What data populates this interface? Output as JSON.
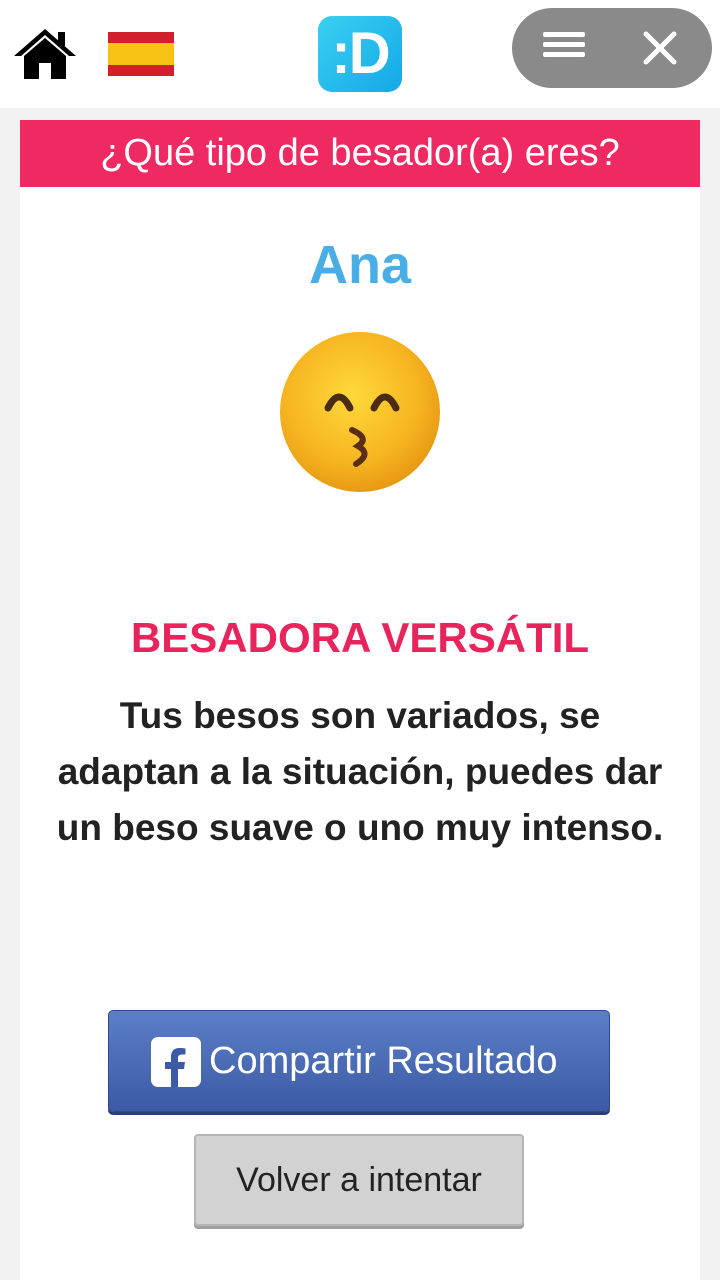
{
  "header": {
    "home_icon": "home-icon",
    "language_icon": "spain-flag-icon",
    "logo_text": ":D",
    "menu_icon": "hamburger-icon",
    "close_icon": "close-icon"
  },
  "quiz": {
    "title": "¿Qué tipo de besador(a) eres?",
    "user_name": "Ana",
    "result_icon": "kissing-face-emoji",
    "result_title": "BESADORA VERSÁTIL",
    "result_description": "Tus besos son variados, se adaptan a la situación, puedes dar un beso suave o uno muy intenso.",
    "share_icon": "facebook-icon",
    "share_label": "Compartir Resultado",
    "retry_label": "Volver a intentar"
  },
  "colors": {
    "banner": "#ef2a62",
    "name": "#4aaee6",
    "result_title": "#e8245c",
    "share_button": "#3c5aa6",
    "retry_button": "#d2d2d2"
  }
}
